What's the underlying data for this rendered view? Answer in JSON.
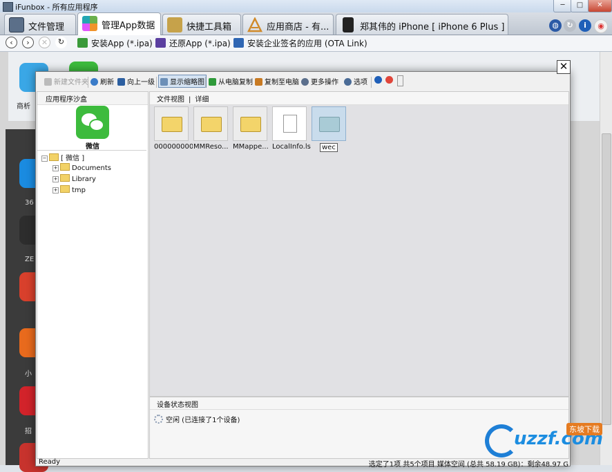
{
  "window": {
    "title": "iFunbox - 所有应用程序",
    "close_glyph": "✕",
    "min_glyph": "─",
    "max_glyph": "□"
  },
  "tabs": [
    {
      "label": "文件管理",
      "icon": "file-manager-icon"
    },
    {
      "label": "管理App数据",
      "icon": "app-data-icon",
      "active": true
    },
    {
      "label": "快捷工具箱",
      "icon": "toolbox-icon"
    },
    {
      "label": "应用商店 - 有...",
      "icon": "app-store-icon"
    },
    {
      "label": "郑其伟的 iPhone [ iPhone 6 Plus ]",
      "icon": "iphone-icon"
    }
  ],
  "actions": {
    "install": "安装App (*.ipa)",
    "restore": "还原App (*.ipa)",
    "install_enterprise": "安装企业签名的应用 (OTA Link)"
  },
  "nav": {
    "back": "‹",
    "forward": "›",
    "stop": "✕",
    "refresh": "↻"
  },
  "background_apps": [
    "商析",
    "36",
    "ZE",
    "小",
    "招"
  ],
  "dialog": {
    "close": "✕",
    "toolbar": {
      "new_folder": "新建文件夹",
      "refresh": "刷新",
      "up": "向上一级",
      "thumbnails": "显示缩略图",
      "copy_from_pc": "从电脑复制",
      "copy_to_pc": "复制至电脑",
      "more": "更多操作",
      "options": "选项"
    },
    "sandbox_header": "应用程序沙盒",
    "app_name": "微信",
    "tree": {
      "root": "[ 微信 ]",
      "children": [
        "Documents",
        "Library",
        "tmp"
      ]
    },
    "view": {
      "file_view": "文件视图",
      "separator": "|",
      "details": "详细"
    },
    "files": [
      {
        "name": "000000000...",
        "type": "folder"
      },
      {
        "name": "MMReso...",
        "type": "folder"
      },
      {
        "name": "MMappe...",
        "type": "folder"
      },
      {
        "name": "LocalInfo.lst",
        "type": "file"
      },
      {
        "name": "wec",
        "type": "folder",
        "editing": true
      }
    ],
    "device_status": {
      "header": "设备状态视图",
      "text": "空闲 (已连接了1个设备)"
    },
    "statusbar": {
      "left": "Ready",
      "right": "选定了1项 共5个项目   媒体空间 (总共 58.19 GB)：剩余48.97 G"
    }
  },
  "watermark": {
    "text": "uzzf.com",
    "tag": "东坡下载"
  }
}
